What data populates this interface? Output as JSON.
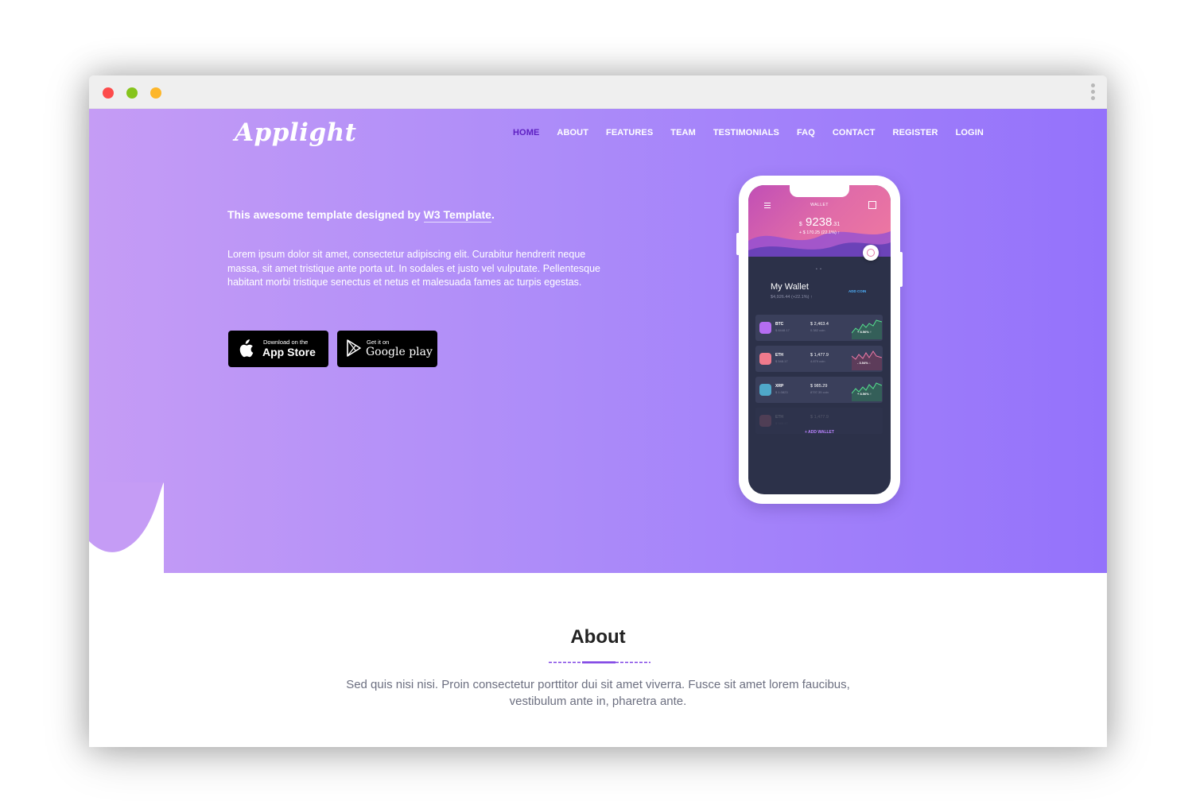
{
  "brand": {
    "logo": "Applight"
  },
  "nav": {
    "items": [
      {
        "label": "HOME"
      },
      {
        "label": "ABOUT"
      },
      {
        "label": "FEATURES"
      },
      {
        "label": "TEAM"
      },
      {
        "label": "TESTIMONIALS"
      },
      {
        "label": "FAQ"
      },
      {
        "label": "CONTACT"
      },
      {
        "label": "REGISTER"
      },
      {
        "label": "LOGIN"
      }
    ],
    "active": "HOME"
  },
  "hero": {
    "lead_prefix": "This awesome template designed by ",
    "lead_link": "W3 Template",
    "lead_suffix": ".",
    "body": "Lorem ipsum dolor sit amet, consectetur adipiscing elit. Curabitur hendrerit neque massa, sit amet tristique ante porta ut. In sodales et justo vel vulputate. Pellentesque habitant morbi tristique senectus et netus et malesuada fames ac turpis egestas.",
    "app_store": {
      "small": "Download on the",
      "big": "App Store"
    },
    "google_play": {
      "small": "Get it on",
      "big": "Google play"
    }
  },
  "phone": {
    "title": "WALLET",
    "amount_prefix": "$",
    "amount": "9238",
    "amount_cents": ".31",
    "change": "+ $ 170.25 (22.1%) ↑",
    "pager": "• •",
    "my_wallet": "My Wallet",
    "wallet_sub": "$4,926.44 (+22.1%) ↑",
    "add_coin": "ADD COIN",
    "add_wallet": "+ ADD WALLET",
    "coins": [
      {
        "sym": "BTC",
        "sub": "$ 8448.17",
        "value": "$ 2,463.4",
        "amount": "0.382 coin",
        "pct": "+ 8.56% ↑",
        "color": "#b56df2",
        "trend": "up"
      },
      {
        "sym": "ETH",
        "sub": "$ 548.17",
        "value": "$ 1,477.9",
        "amount": "4.879 coin",
        "pct": "- 3.54% ↓",
        "color": "#f07a8c",
        "trend": "down"
      },
      {
        "sym": "XRP",
        "sub": "$ 1.0823",
        "value": "$ 985.29",
        "amount": "8797.35 coin",
        "pct": "+ 8.56% ↑",
        "color": "#4fa8c9",
        "trend": "up"
      },
      {
        "sym": "ETH",
        "sub": "$ 548.17",
        "value": "$ 1,477.9",
        "amount": "",
        "pct": "",
        "color": "#f07a8c",
        "trend": "down"
      }
    ]
  },
  "about": {
    "title": "About",
    "text": "Sed quis nisi nisi. Proin consectetur porttitor dui sit amet viverra. Fusce sit amet lorem faucibus, vestibulum ante in, pharetra ante."
  },
  "colors": {
    "accent": "#5d1fc2",
    "gradient_start": "#c59cf5",
    "gradient_end": "#9472fb"
  }
}
